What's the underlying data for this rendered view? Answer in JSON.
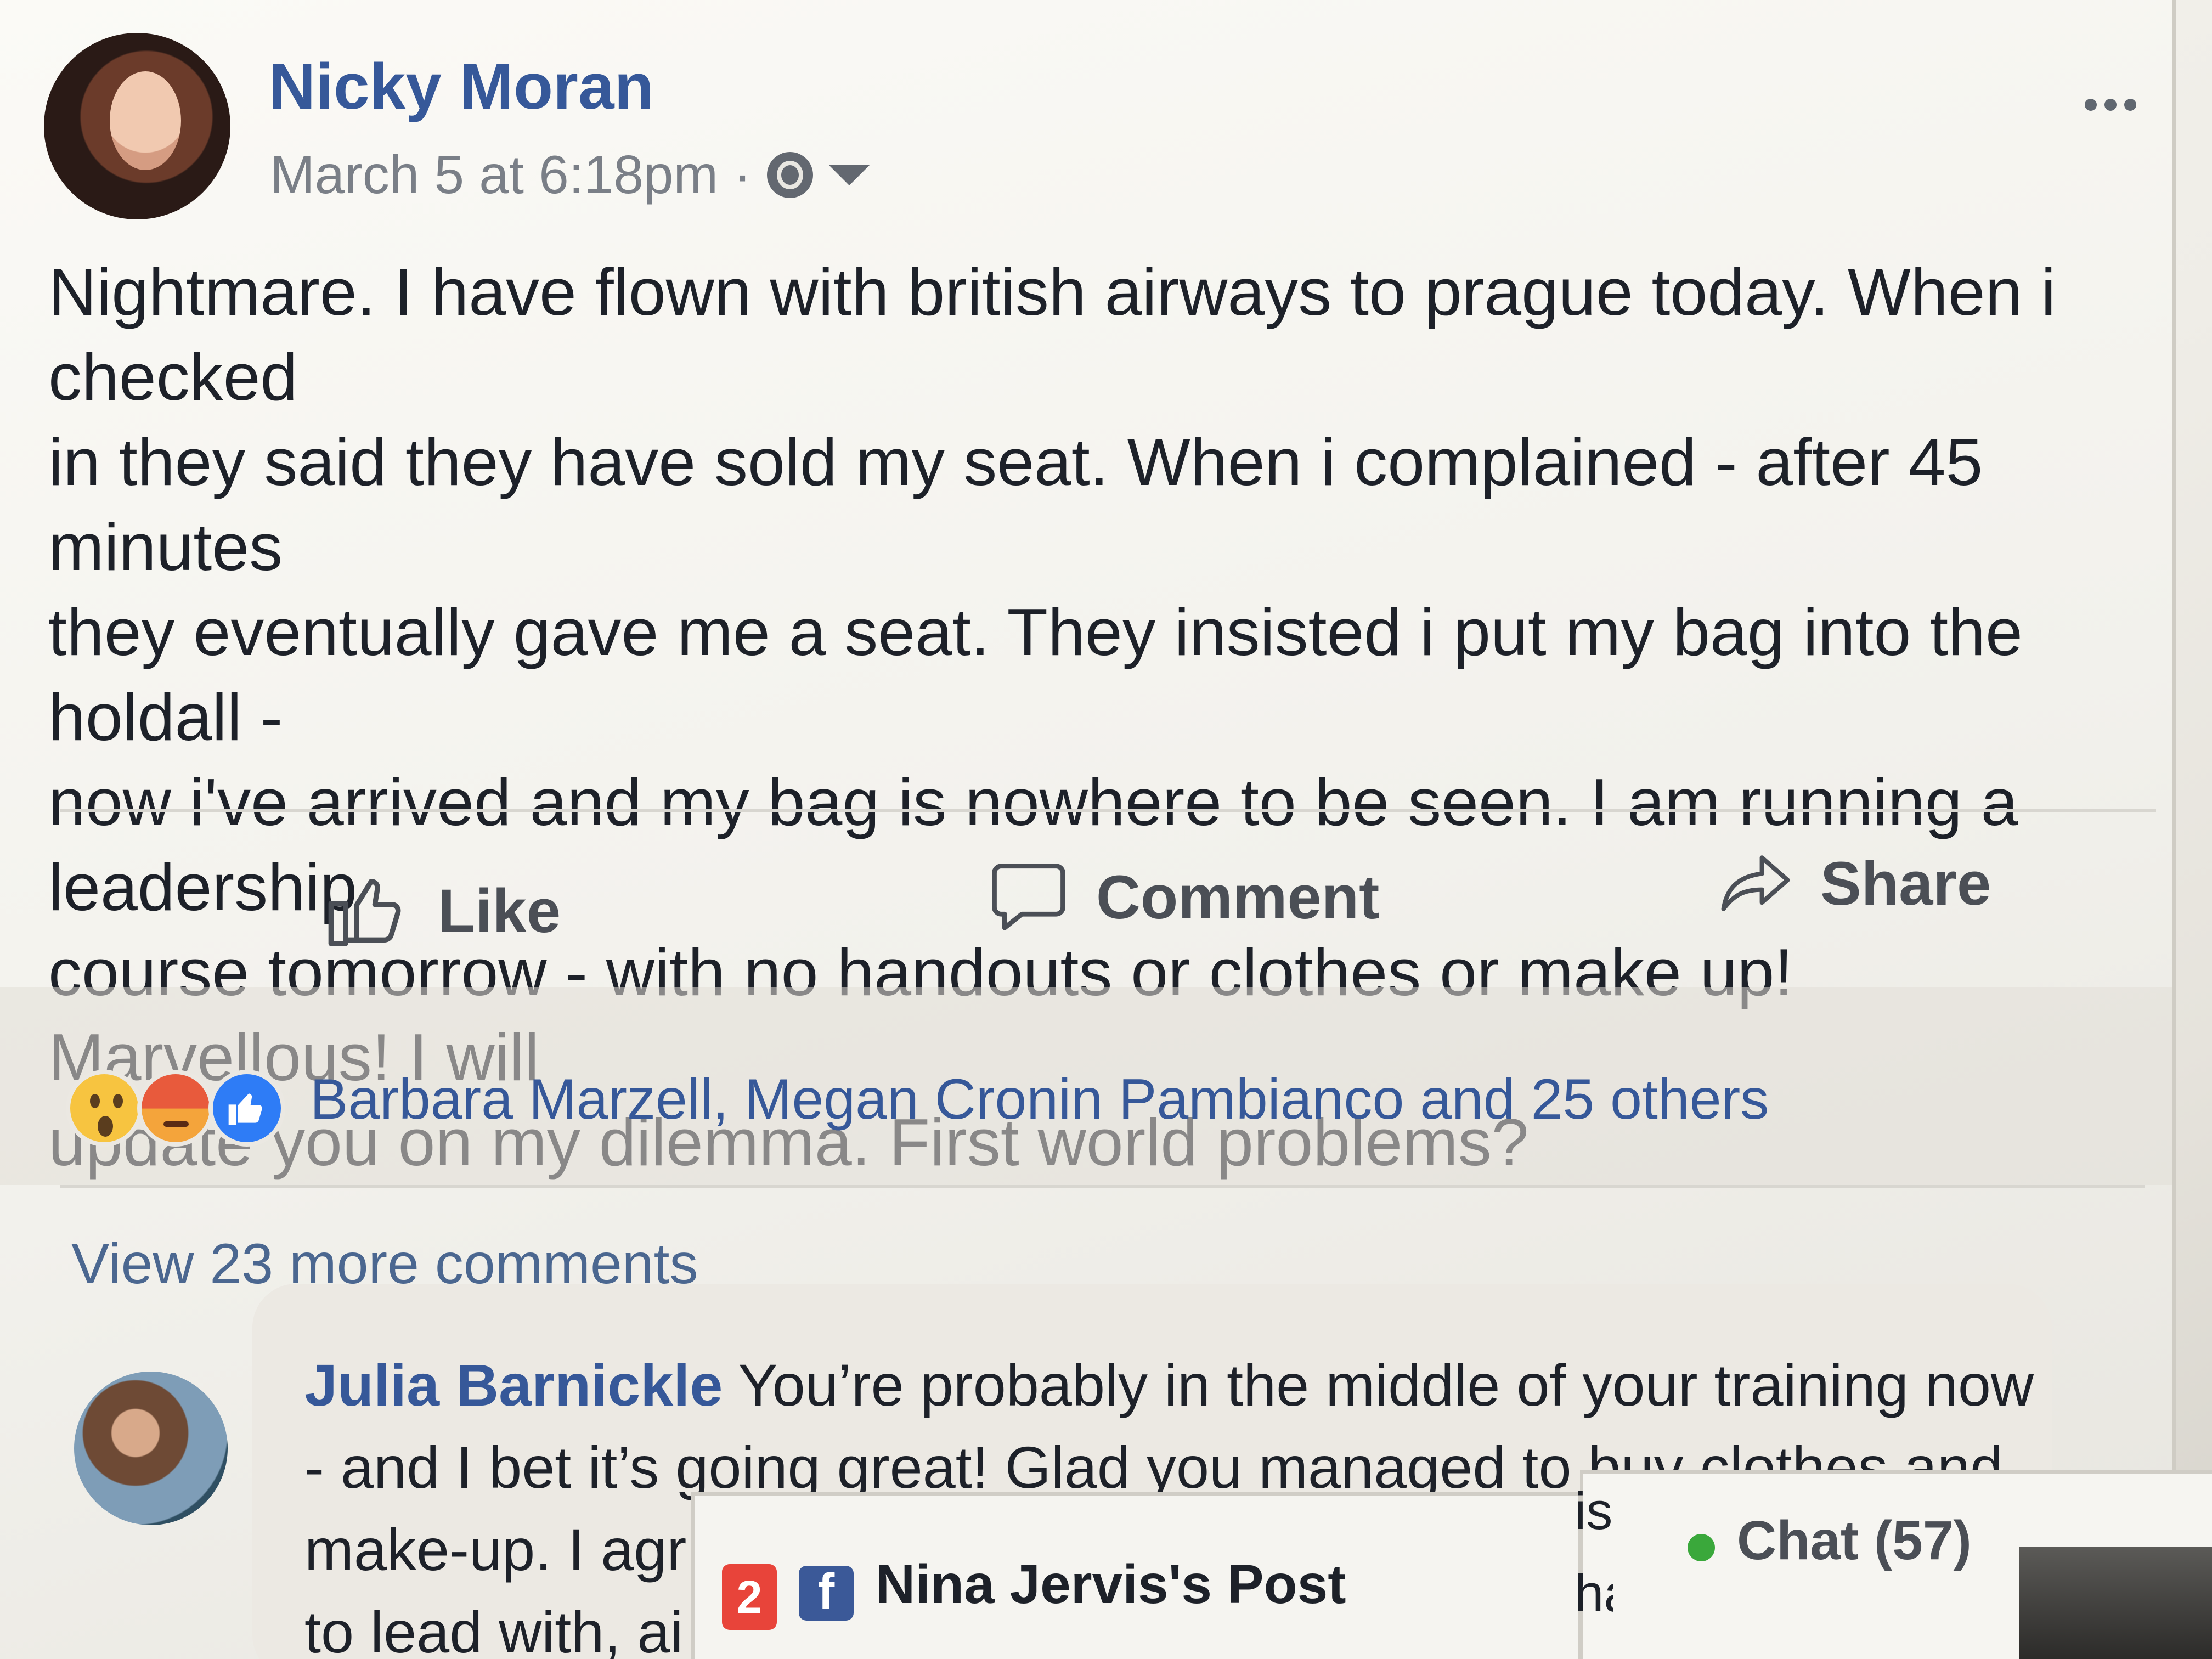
{
  "post": {
    "author": "Nicky Moran",
    "timestamp": "March 5 at 6:18pm",
    "separator": "·",
    "audience_icon": "globe-icon",
    "more_icon": "ellipsis-icon",
    "body": "Nightmare. I have flown with british airways to prague today. When i checked\nin they said they have sold my seat. When i complained - after 45 minutes\nthey eventually gave me a seat. They insisted i put my bag into the holdall -\nnow i've arrived and my bag is nowhere to be seen. I am running a leadership\ncourse tomorrow - with no handouts or clothes or make up! Marvellous! I will\nupdate you on my dilemma. First world problems?"
  },
  "actions": {
    "like_label": "Like",
    "comment_label": "Comment",
    "share_label": "Share"
  },
  "reactions": {
    "icons": [
      "wow-icon",
      "angry-icon",
      "like-icon"
    ],
    "summary": "Barbara Marzell, Megan Cronin Pambianco and 25 others"
  },
  "comments": {
    "view_more_label": "View 23 more comments",
    "items": [
      {
        "name": "Julia Barnickle",
        "text": " You’re probably in the middle of your training now - and I bet it’s going great! Glad you managed to buy clothes and make-up. I agr",
        "text_tail": "to lead with, ai"
      }
    ]
  },
  "chat": {
    "label": "Chat (57)",
    "status_color": "#3aa83b",
    "peek_lines": [
      "is",
      "ha"
    ]
  },
  "post_tab": {
    "badge_count": "2",
    "icon": "facebook-icon",
    "title": "Nina Jervis's Post"
  },
  "colors": {
    "link_blue": "#365899",
    "badge_red": "#e8443a",
    "like_blue": "#2e7cf6"
  }
}
